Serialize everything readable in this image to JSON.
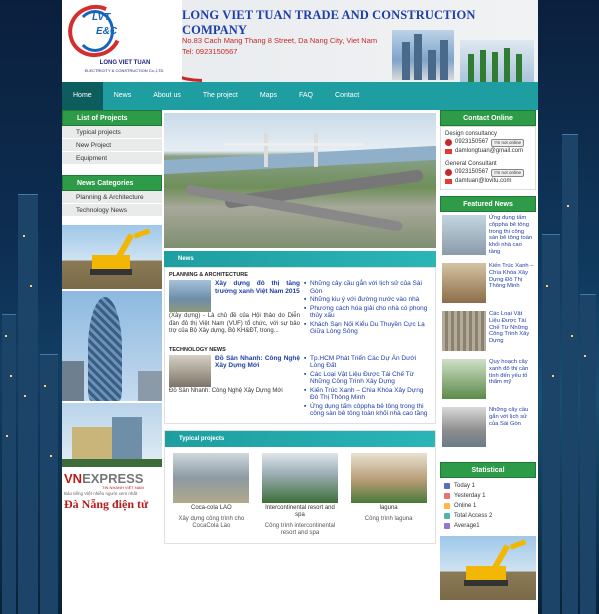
{
  "header": {
    "company": "LONG VIET TUAN TRADE AND CONSTRUCTION COMPANY",
    "address": "No.83 Cach Mang Thang 8 Street, Da Nang City, Viet Nam",
    "phone": "Tel: 0923150567",
    "logo_text_1": "LVT",
    "logo_text_2": "E&C",
    "logo_name": "LONG VIET TUAN",
    "logo_sub": "ELECTRICITY & CONSTRUCTION Co.,LTD"
  },
  "nav": [
    "Home",
    "News",
    "About us",
    "The project",
    "Maps",
    "FAQ",
    "Contact"
  ],
  "left": {
    "projects_title": "List of Projects",
    "projects": [
      "Typical projects",
      "New Project",
      "Equipment"
    ],
    "news_title": "News Categories",
    "news_cats": [
      "Planning & Architecture",
      "Technology News"
    ],
    "vne_1": "VN",
    "vne_2": "EXPRESS",
    "vne_tag": "TIN NHANH VIỆT NAM",
    "vne_line": "Báo tiếng Việt nhiều người xem nhất",
    "danang": "Đà Nẵng điện tử"
  },
  "center": {
    "news_title": "News",
    "cat1": "PLANNING & ARCHITECTURE",
    "cat1_title": "Xây dựng đô thị tăng trưởng xanh Việt Nam 2015",
    "cat1_desc": "(Xây dựng) - Là chủ đề của Hội thảo do Diễn đàn đô thị Việt Nam (VUF) tổ chức, với sự bảo trợ của Bộ Xây dựng, Bộ KH&ĐT, trong...",
    "cat1_links": [
      "Những cây cầu gắn với lịch sử của Sài Gòn",
      "Những kiu ý với đường nước vào nhà",
      "Phương cách hóa giải cho nhà có phong thủy xấu",
      "Khách Sạn Nối Kiểu Du Thuyền Cực Lạ Giữa Lòng Sông"
    ],
    "cat2": "TECHNOLOGY NEWS",
    "cat2_title": "Đồ Sân Nhanh: Công Nghệ Xây Dựng Mới",
    "cat2_desc": "Đồ Sân Nhanh: Công Nghệ Xây Dựng Mới",
    "cat2_links": [
      "Tp.HCM Phát Triển Các Dự Án Dưới Lòng Đất",
      "Các Loại Vật Liệu Được Tái Chế Từ Những Công Trình Xây Dựng",
      "Kiến Trúc Xanh – Chìa Khóa Xây Dựng Đô Thị Thông Minh",
      "Ứng dụng tấm côppha bê tông trong thi công sàn bê tông toàn khối nhà cao tầng"
    ],
    "projects_title": "Typical projects",
    "projects": [
      {
        "name": "Coca-cola LAO",
        "desc": "Xây dựng công trình cho CocaCola Lào"
      },
      {
        "name": "Intercontinental resort and spa",
        "desc": "Công trình intercontinental resort and spa"
      },
      {
        "name": "laguna",
        "desc": "Công trình laguna"
      }
    ]
  },
  "right": {
    "contact_title": "Contact Online",
    "design_label": "Design consultancy",
    "design_phone": "0923150567",
    "design_email": "damlongtuan@gmail.com",
    "general_label": "General Consultant",
    "general_phone": "0923150567",
    "general_email": "damtuan@lovitu.com",
    "online_badge": "I'm not online",
    "featured_title": "Featured News",
    "featured": [
      "Ứng dụng tấm côppha bê tông trong thi công sàn bê tông toàn khối nhà cao tầng",
      "Kiến Trúc Xanh – Chìa Khóa Xây Dựng Đô Thị Thông Minh",
      "Các Loại Vật Liệu Được Tái Chế Từ Những Công Trình Xây Dựng",
      "Quy hoạch cây xanh đô thị cần tính đến yếu tố thẩm mỹ",
      "Những cây cầu gắn với lịch sử của Sài Gòn"
    ],
    "stat_title": "Statistical",
    "stats": [
      "Today 1",
      "Yesterday 1",
      "Online 1",
      "Total Access 2",
      "Average1"
    ]
  },
  "colors": {
    "nav": "#1e9ea0",
    "box_header": "#2e9b48",
    "title_blue": "#1e3ea8",
    "accent_red": "#c62828"
  }
}
